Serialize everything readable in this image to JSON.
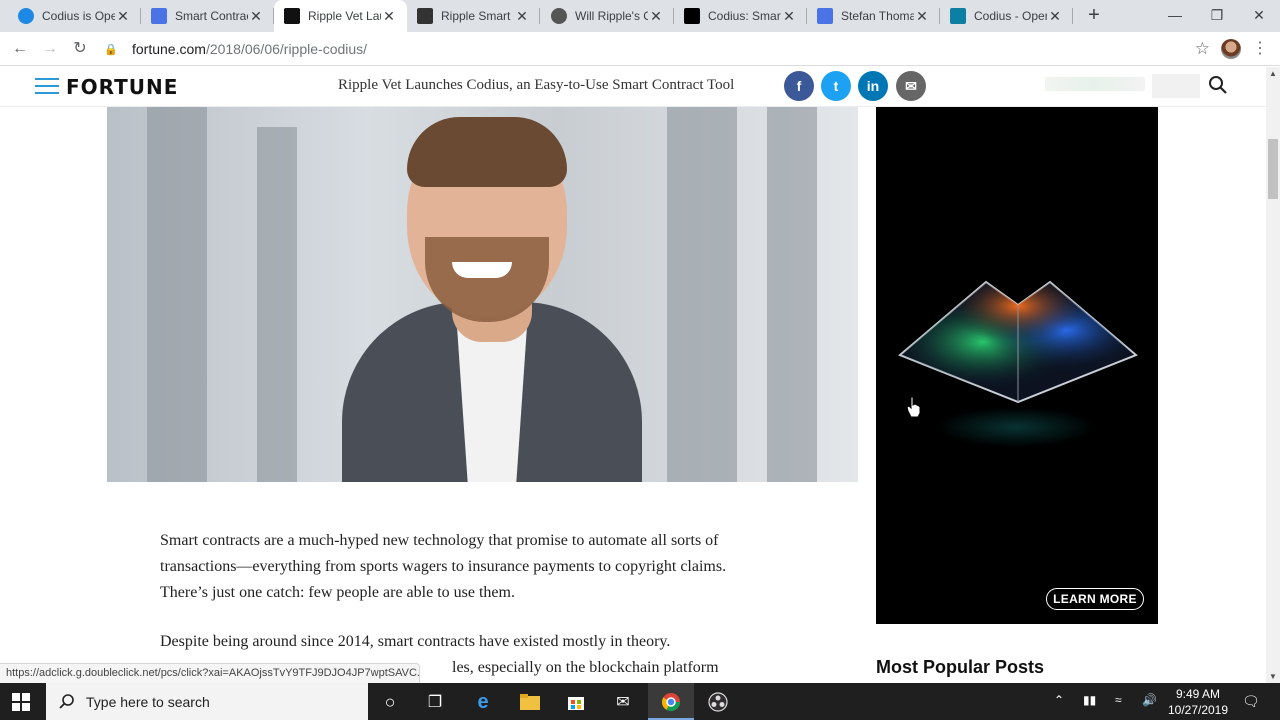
{
  "browser": {
    "tabs": [
      {
        "title": "Codius is Oper",
        "favicon": "ripple-icon",
        "color": "#1e88e5",
        "active": false
      },
      {
        "title": "Smart Contrac",
        "favicon": "ethereum-icon",
        "color": "#4a74e6",
        "active": false
      },
      {
        "title": "Ripple Vet Lau",
        "favicon": "fortune-icon",
        "color": "#111111",
        "active": true
      },
      {
        "title": "Ripple Smart C",
        "favicon": "ripple-smart-icon",
        "color": "#333333",
        "active": false
      },
      {
        "title": "Will Ripple's C",
        "favicon": "globe-icon",
        "color": "#555555",
        "active": false
      },
      {
        "title": "Codius: Smart",
        "favicon": "medium-icon",
        "color": "#000000",
        "active": false
      },
      {
        "title": "Stefan Thomas",
        "favicon": "ethereum-icon",
        "color": "#4a74e6",
        "active": false
      },
      {
        "title": "Codius - Oper",
        "favicon": "codius-icon",
        "color": "#0d7fa3",
        "active": false
      }
    ],
    "url_host": "fortune.com",
    "url_path": "/2018/06/06/ripple-codius/",
    "status_url": "https://adclick.g.doubleclick.net/pcs/click?xai=AKAOjssTvY9TFJ9DJO4JP7wptSAVC..."
  },
  "site": {
    "logo": "FORTUNE",
    "headline": "Ripple Vet Launches Codius, an Easy-to-Use Smart Contract Tool",
    "share": [
      {
        "name": "facebook-share-button",
        "glyph": "f",
        "color": "#3b5998"
      },
      {
        "name": "twitter-share-button",
        "glyph": "t",
        "color": "#1da1f2"
      },
      {
        "name": "linkedin-share-button",
        "glyph": "in",
        "color": "#0077b5"
      },
      {
        "name": "email-share-button",
        "glyph": "✉",
        "color": "#666666"
      }
    ]
  },
  "article": {
    "p1": "Smart contracts are a much-hyped new technology that promise to automate all sorts of transactions—everything from sports wagers to insurance payments to copyright claims. There’s just one catch: few people are able to use them.",
    "p2": "Despite being around since 2014, smart contracts have existed mostly in theory.",
    "p2_tail": "les, especially on the blockchain platform"
  },
  "ad": {
    "cta": "LEARN MORE"
  },
  "sidebar": {
    "most_popular": "Most Popular Posts"
  },
  "taskbar": {
    "search_placeholder": "Type here to search",
    "time": "9:49 AM",
    "date": "10/27/2019"
  }
}
